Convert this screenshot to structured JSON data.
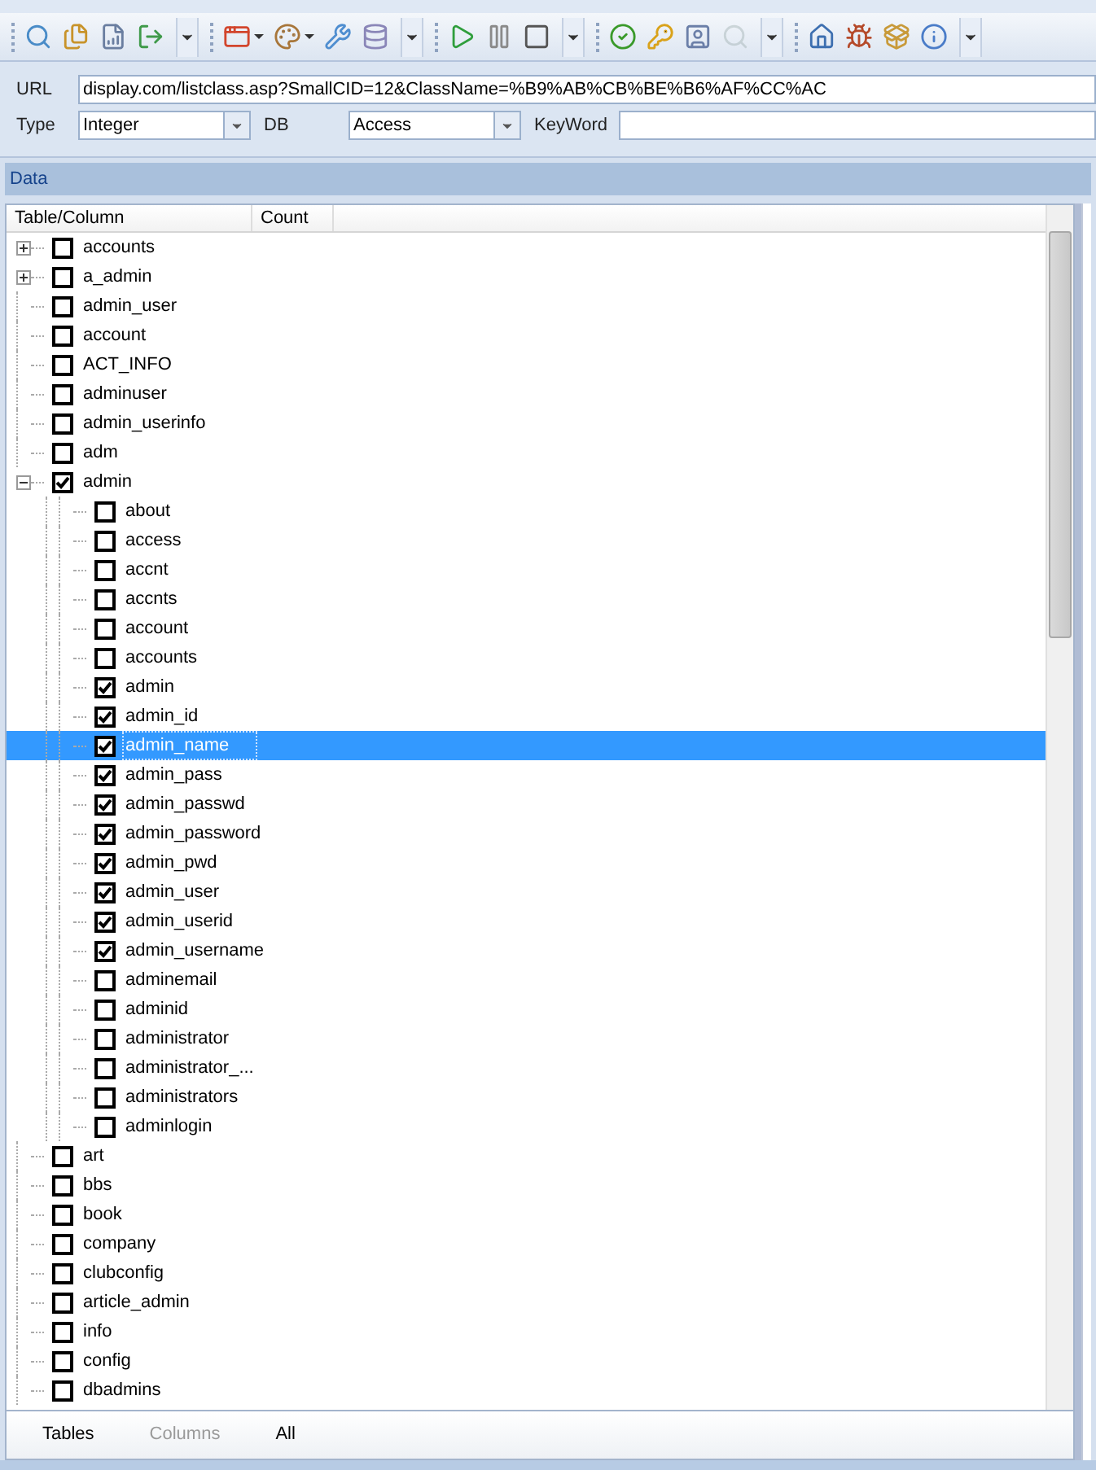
{
  "toolbar": {
    "groups": [
      {
        "icons": [
          {
            "kind": "search",
            "disabled": false
          },
          {
            "kind": "pages",
            "disabled": false
          },
          {
            "kind": "report",
            "disabled": false
          },
          {
            "kind": "exit",
            "disabled": false
          }
        ]
      },
      {
        "icons": [
          {
            "kind": "app",
            "disabled": false
          },
          {
            "kind": "palette",
            "disabled": false
          },
          {
            "kind": "wrench",
            "disabled": false
          },
          {
            "kind": "database",
            "disabled": false
          }
        ]
      },
      {
        "icons": [
          {
            "kind": "play",
            "disabled": false
          },
          {
            "kind": "pause",
            "disabled": false
          },
          {
            "kind": "stop",
            "disabled": false
          }
        ]
      },
      {
        "icons": [
          {
            "kind": "check",
            "disabled": false
          },
          {
            "kind": "key",
            "disabled": false
          },
          {
            "kind": "user",
            "disabled": false
          },
          {
            "kind": "search",
            "disabled": true
          }
        ]
      },
      {
        "icons": [
          {
            "kind": "home",
            "disabled": false
          },
          {
            "kind": "bug",
            "disabled": false
          },
          {
            "kind": "package",
            "disabled": false
          },
          {
            "kind": "info",
            "disabled": false
          }
        ]
      }
    ]
  },
  "form": {
    "url_label": "URL",
    "url_value": "display.com/listclass.asp?SmallCID=12&ClassName=%B9%AB%CB%BE%B6%AF%CC%AC",
    "type_label": "Type",
    "type_value": "Integer",
    "db_label": "DB",
    "db_value": "Access",
    "keyword_label": "KeyWord"
  },
  "data_panel": {
    "title": "Data",
    "columns": [
      "Table/Column",
      "Count"
    ],
    "tree": [
      {
        "label": "accounts",
        "checked": false,
        "expanded": false,
        "selected": false
      },
      {
        "label": "a_admin",
        "checked": false,
        "expanded": false,
        "selected": false
      },
      {
        "label": "admin_user",
        "checked": false,
        "selected": false
      },
      {
        "label": "account",
        "checked": false,
        "selected": false
      },
      {
        "label": "ACT_INFO",
        "checked": false,
        "selected": false
      },
      {
        "label": "adminuser",
        "checked": false,
        "selected": false
      },
      {
        "label": "admin_userinfo",
        "checked": false,
        "selected": false
      },
      {
        "label": "adm",
        "checked": false,
        "selected": false
      },
      {
        "label": "admin",
        "checked": true,
        "expanded": true,
        "selected": false,
        "children": [
          {
            "label": "about",
            "checked": false,
            "selected": false
          },
          {
            "label": "access",
            "checked": false,
            "selected": false
          },
          {
            "label": "accnt",
            "checked": false,
            "selected": false
          },
          {
            "label": "accnts",
            "checked": false,
            "selected": false
          },
          {
            "label": "account",
            "checked": false,
            "selected": false
          },
          {
            "label": "accounts",
            "checked": false,
            "selected": false
          },
          {
            "label": "admin",
            "checked": true,
            "selected": false
          },
          {
            "label": "admin_id",
            "checked": true,
            "selected": false
          },
          {
            "label": "admin_name",
            "checked": true,
            "selected": true
          },
          {
            "label": "admin_pass",
            "checked": true,
            "selected": false
          },
          {
            "label": "admin_passwd",
            "checked": true,
            "selected": false
          },
          {
            "label": "admin_password",
            "checked": true,
            "selected": false
          },
          {
            "label": "admin_pwd",
            "checked": true,
            "selected": false
          },
          {
            "label": "admin_user",
            "checked": true,
            "selected": false
          },
          {
            "label": "admin_userid",
            "checked": true,
            "selected": false
          },
          {
            "label": "admin_username",
            "checked": true,
            "selected": false
          },
          {
            "label": "adminemail",
            "checked": false,
            "selected": false
          },
          {
            "label": "adminid",
            "checked": false,
            "selected": false
          },
          {
            "label": "administrator",
            "checked": false,
            "selected": false
          },
          {
            "label": "administrator_...",
            "checked": false,
            "selected": false
          },
          {
            "label": "administrators",
            "checked": false,
            "selected": false
          },
          {
            "label": "adminlogin",
            "checked": false,
            "selected": false
          }
        ]
      },
      {
        "label": "art",
        "checked": false,
        "selected": false
      },
      {
        "label": "bbs",
        "checked": false,
        "selected": false
      },
      {
        "label": "book",
        "checked": false,
        "selected": false
      },
      {
        "label": "company",
        "checked": false,
        "selected": false
      },
      {
        "label": "clubconfig",
        "checked": false,
        "selected": false
      },
      {
        "label": "article_admin",
        "checked": false,
        "selected": false
      },
      {
        "label": "info",
        "checked": false,
        "selected": false
      },
      {
        "label": "config",
        "checked": false,
        "selected": false
      },
      {
        "label": "dbadmins",
        "checked": false,
        "selected": false
      }
    ],
    "tabs": [
      {
        "label": "Tables",
        "disabled": false
      },
      {
        "label": "Columns",
        "disabled": true
      },
      {
        "label": "All",
        "disabled": false
      }
    ]
  }
}
